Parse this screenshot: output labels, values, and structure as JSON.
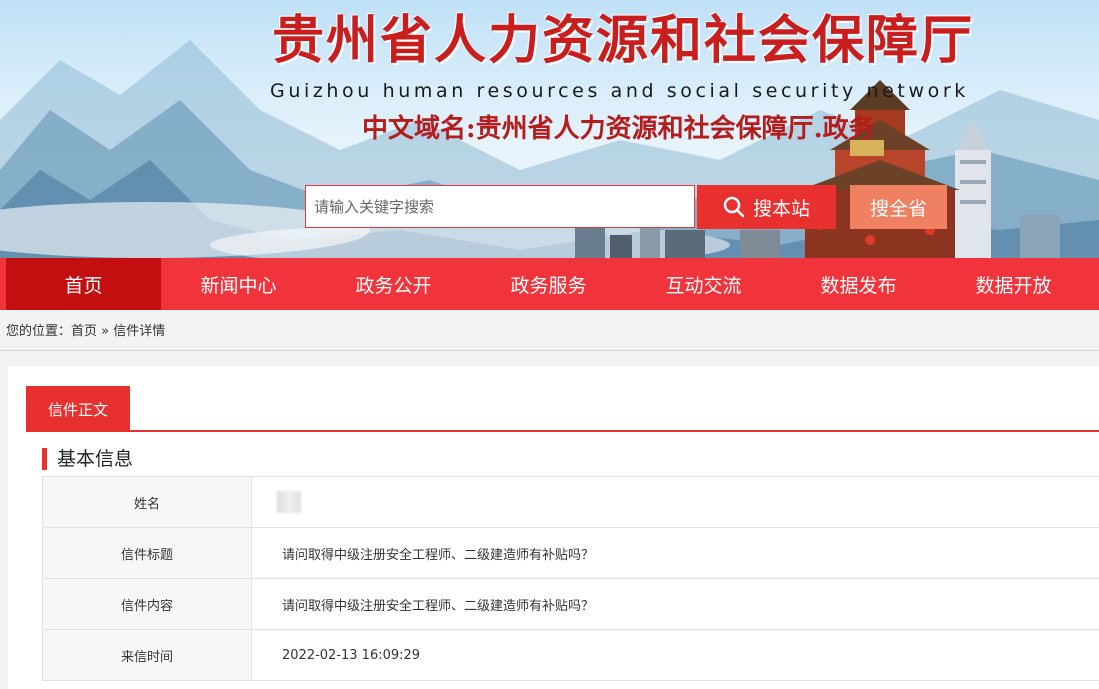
{
  "header": {
    "title": "贵州省人力资源和社会保障厅",
    "subtitle": "Guizhou human resources and social security network",
    "domain": "中文域名:贵州省人力资源和社会保障厅.政务"
  },
  "search": {
    "placeholder": "请输入关键字搜索",
    "btn_site": "搜本站",
    "btn_province": "搜全省"
  },
  "nav": [
    "首页",
    "新闻中心",
    "政务公开",
    "政务服务",
    "互动交流",
    "数据发布",
    "数据开放"
  ],
  "breadcrumb": {
    "label": "您的位置：",
    "home": "首页",
    "sep": "»",
    "current": "信件详情"
  },
  "tab": {
    "label": "信件正文"
  },
  "section": {
    "title": "基本信息"
  },
  "rows": [
    {
      "key": "姓名",
      "value": ""
    },
    {
      "key": "信件标题",
      "value": "请问取得中级注册安全工程师、二级建造师有补贴吗？"
    },
    {
      "key": "信件内容",
      "value": "请问取得中级注册安全工程师、二级建造师有补贴吗？"
    },
    {
      "key": "来信时间",
      "value": "2022-02-13 16:09:29"
    }
  ],
  "colors": {
    "primary_red": "#f1333b",
    "active_red": "#c40f10",
    "accent_orange": "#f08062"
  },
  "icons": {
    "search_button": "search-icon"
  }
}
